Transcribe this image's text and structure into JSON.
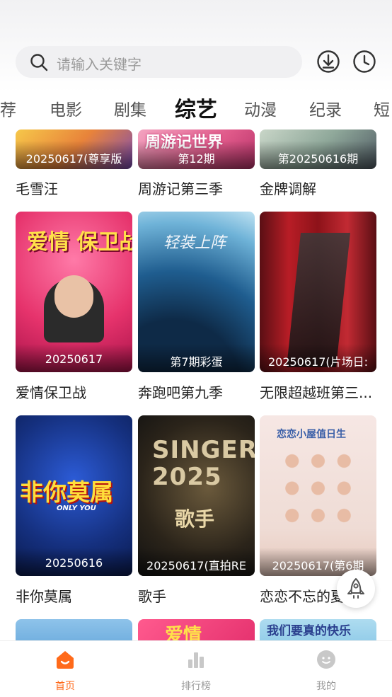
{
  "search": {
    "placeholder": "请输入关键字"
  },
  "tabs": [
    "荐",
    "电影",
    "剧集",
    "综艺",
    "动漫",
    "纪录",
    "短"
  ],
  "active_tab": "综艺",
  "cards": [
    {
      "title": "毛雪汪",
      "badge": "20250617(尊享版"
    },
    {
      "title": "周游记第三季",
      "badge": "第12期",
      "art": "周游记世界"
    },
    {
      "title": "金牌调解",
      "badge": "第20250616期"
    },
    {
      "title": "爱情保卫战",
      "badge": "20250617",
      "art": "爱情 保卫战"
    },
    {
      "title": "奔跑吧第九季",
      "badge": "第7期彩蛋",
      "art": "轻装上阵"
    },
    {
      "title": "无限超越班第三...",
      "badge": "20250617(片场日:"
    },
    {
      "title": "非你莫属",
      "badge": "20250616",
      "art": "非你莫属",
      "art_sub": "ONLY YOU"
    },
    {
      "title": "歌手",
      "badge": "20250617(直拍RE",
      "art": "SINGER 2025",
      "art_sub": "歌手"
    },
    {
      "title": "恋恋不忘的夏天",
      "badge": "20250617(第6期",
      "art": "恋恋小屋值日生"
    },
    {
      "title": "",
      "badge": ""
    },
    {
      "title": "",
      "badge": "",
      "art": "爱情"
    },
    {
      "title": "",
      "badge": "",
      "art": "我们要真的快乐"
    }
  ],
  "nav": [
    {
      "label": "首页",
      "icon": "home-icon",
      "active": true
    },
    {
      "label": "排行榜",
      "icon": "ranking-icon",
      "active": false
    },
    {
      "label": "我的",
      "icon": "profile-icon",
      "active": false
    }
  ],
  "colors": {
    "accent": "#ff6a1a",
    "inactive": "#999999",
    "search_bg": "#f0f0f2"
  }
}
